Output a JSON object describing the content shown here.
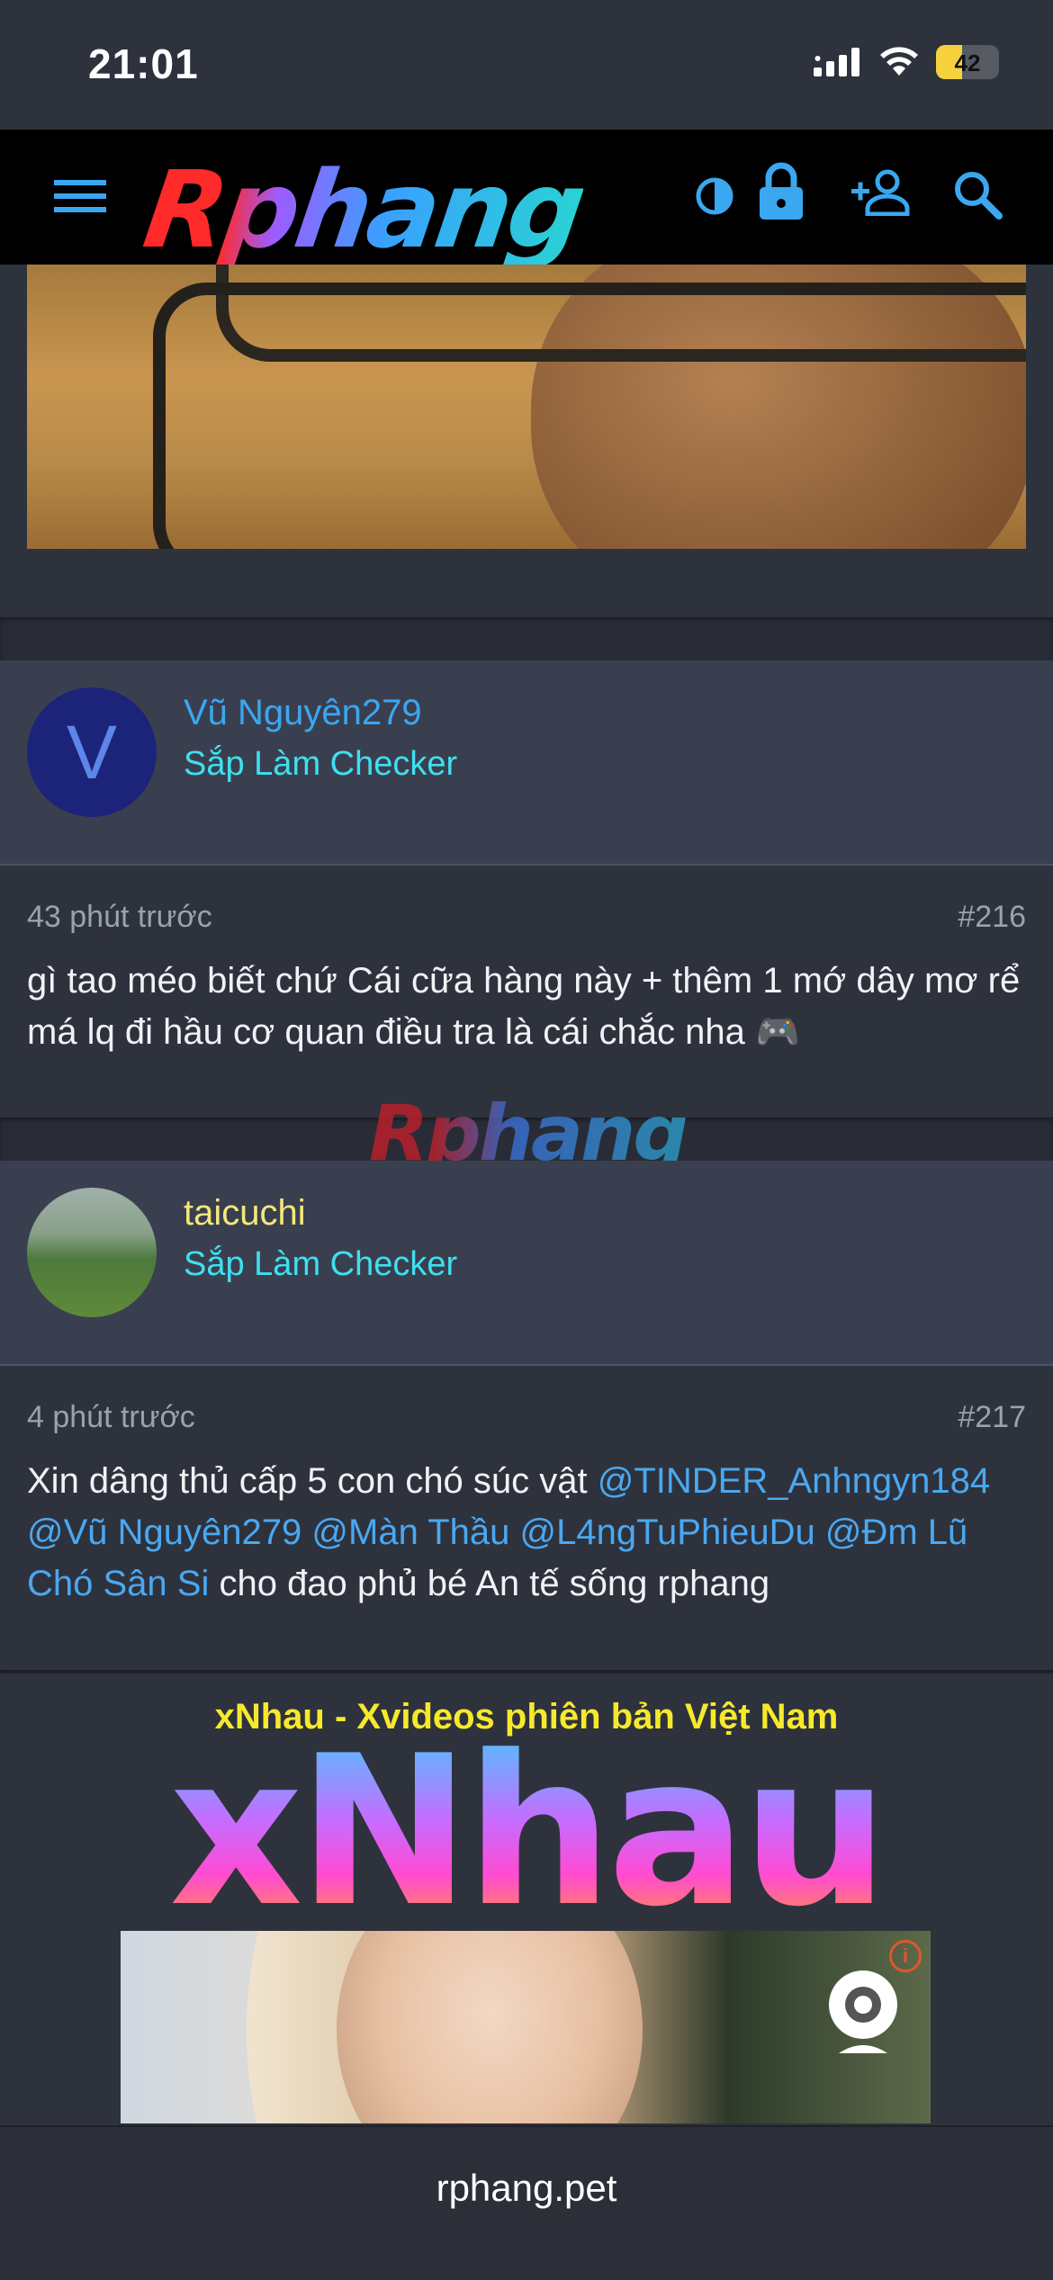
{
  "status_bar": {
    "time": "21:01",
    "battery": "42",
    "battery_fraction": 0.42
  },
  "header": {
    "logo": "Rphang"
  },
  "posts": [
    {
      "user": {
        "avatar_letter": "V",
        "name": "Vũ Nguyên279",
        "title": "Sắp Làm Checker",
        "name_color": "#3aa7f0"
      },
      "time": "43 phút trước",
      "number": "#216",
      "content": "gì tao méo biết chứ Cái cữa hàng này + thêm 1 mớ dây mơ rể má lq đi hầu cơ quan điều tra là cái chắc nha",
      "emoji": "🎮"
    },
    {
      "user": {
        "name": "taicuchi",
        "title": "Sắp Làm Checker",
        "name_color": "#f3e97a"
      },
      "time": "4 phút trước",
      "number": "#217",
      "content_parts": [
        "Xin dâng thủ cấp 5 con chó súc vật ",
        "@TINDER_Anhngyn184",
        " ",
        "@Vũ Nguyên279",
        " ",
        "@Màn Thầu",
        " ",
        "@L4ngTuPhieuDu",
        " ",
        "@Đm Lũ Chó Sân Si",
        " cho đao phủ bé An tế sống rphang"
      ]
    }
  ],
  "watermark": "Rphang",
  "ad": {
    "title": "xNhau - Xvideos phiên bản Việt Nam",
    "logo": "xNhau",
    "info_icon": "i"
  },
  "browser": {
    "url": "rphang.pet"
  },
  "colors": {
    "accent": "#3aa7f0",
    "user_title": "#3ee0ef",
    "bg": "#2e323d"
  }
}
